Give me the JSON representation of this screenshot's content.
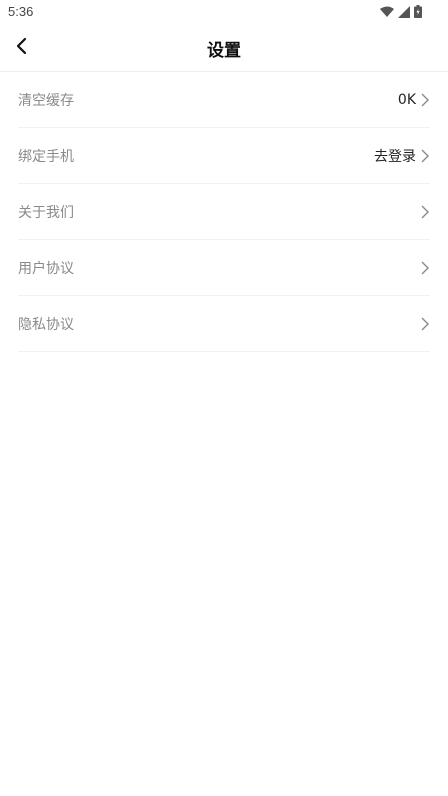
{
  "status_bar": {
    "time": "5:36",
    "icons": [
      "wifi-icon",
      "signal-icon",
      "battery-icon"
    ]
  },
  "nav": {
    "back_icon": "back-arrow-icon",
    "title": "设置"
  },
  "settings": {
    "items": [
      {
        "label": "清空缓存",
        "value": "0K"
      },
      {
        "label": "绑定手机",
        "value": "去登录"
      },
      {
        "label": "关于我们",
        "value": ""
      },
      {
        "label": "用户协议",
        "value": ""
      },
      {
        "label": "隐私协议",
        "value": ""
      }
    ]
  },
  "colors": {
    "label": "#8a8a8a",
    "value": "#222222",
    "chevron": "#8a8a8a",
    "divider": "#f1f1f1"
  }
}
